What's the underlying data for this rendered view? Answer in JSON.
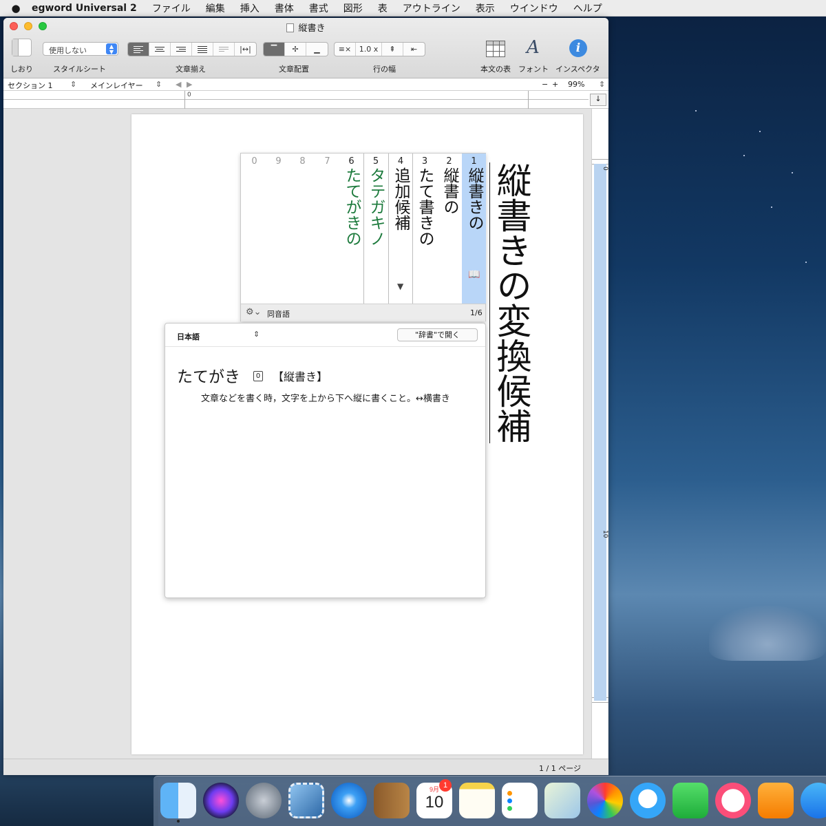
{
  "menubar": {
    "app_name": "egword Universal 2",
    "items": [
      "ファイル",
      "編集",
      "挿入",
      "書体",
      "書式",
      "図形",
      "表",
      "アウトライン",
      "表示",
      "ウインドウ",
      "ヘルプ"
    ]
  },
  "window": {
    "title": "縦書き"
  },
  "toolbar": {
    "bookmark_label": "しおり",
    "stylesheet_label": "スタイルシート",
    "stylesheet_value": "使用しない",
    "align_label": "文章揃え",
    "vertical_align_label": "文章配置",
    "line_spacing_label": "行の幅",
    "line_spacing_value": "1.0 x",
    "table_label": "本文の表",
    "font_label": "フォント",
    "inspector_label": "インスペクタ"
  },
  "section_bar": {
    "section": "セクション 1",
    "layer": "メインレイヤー",
    "zoom": "99%",
    "ruler_zero": "0"
  },
  "vruler": {
    "mark0": "0",
    "mark10": "10"
  },
  "document": {
    "text": "縦書きの変換候補"
  },
  "candidates": {
    "items": [
      {
        "num": "1",
        "word": "縦書きの"
      },
      {
        "num": "2",
        "word": "縦書の"
      },
      {
        "num": "3",
        "word": "たて書きの"
      },
      {
        "num": "4",
        "word": "追加候補"
      },
      {
        "num": "5",
        "word": "タテガキノ"
      },
      {
        "num": "6",
        "word": "たてがきの"
      },
      {
        "num": "7",
        "word": ""
      },
      {
        "num": "8",
        "word": ""
      },
      {
        "num": "9",
        "word": ""
      },
      {
        "num": "0",
        "word": ""
      }
    ],
    "footer_label": "同音語",
    "count": "1/6"
  },
  "dictionary": {
    "language": "日本語",
    "open_button": "\"辞書\"で開く",
    "headword": "たてがき",
    "badge": "0",
    "kanji": "【縦書き】",
    "definition": "文章などを書く時，文字を上から下へ縦に書くこと。↔横書き"
  },
  "status": {
    "pages": "1 / 1 ページ"
  },
  "dock": {
    "calendar_month": "9月",
    "calendar_day": "10",
    "calendar_badge": "1"
  }
}
